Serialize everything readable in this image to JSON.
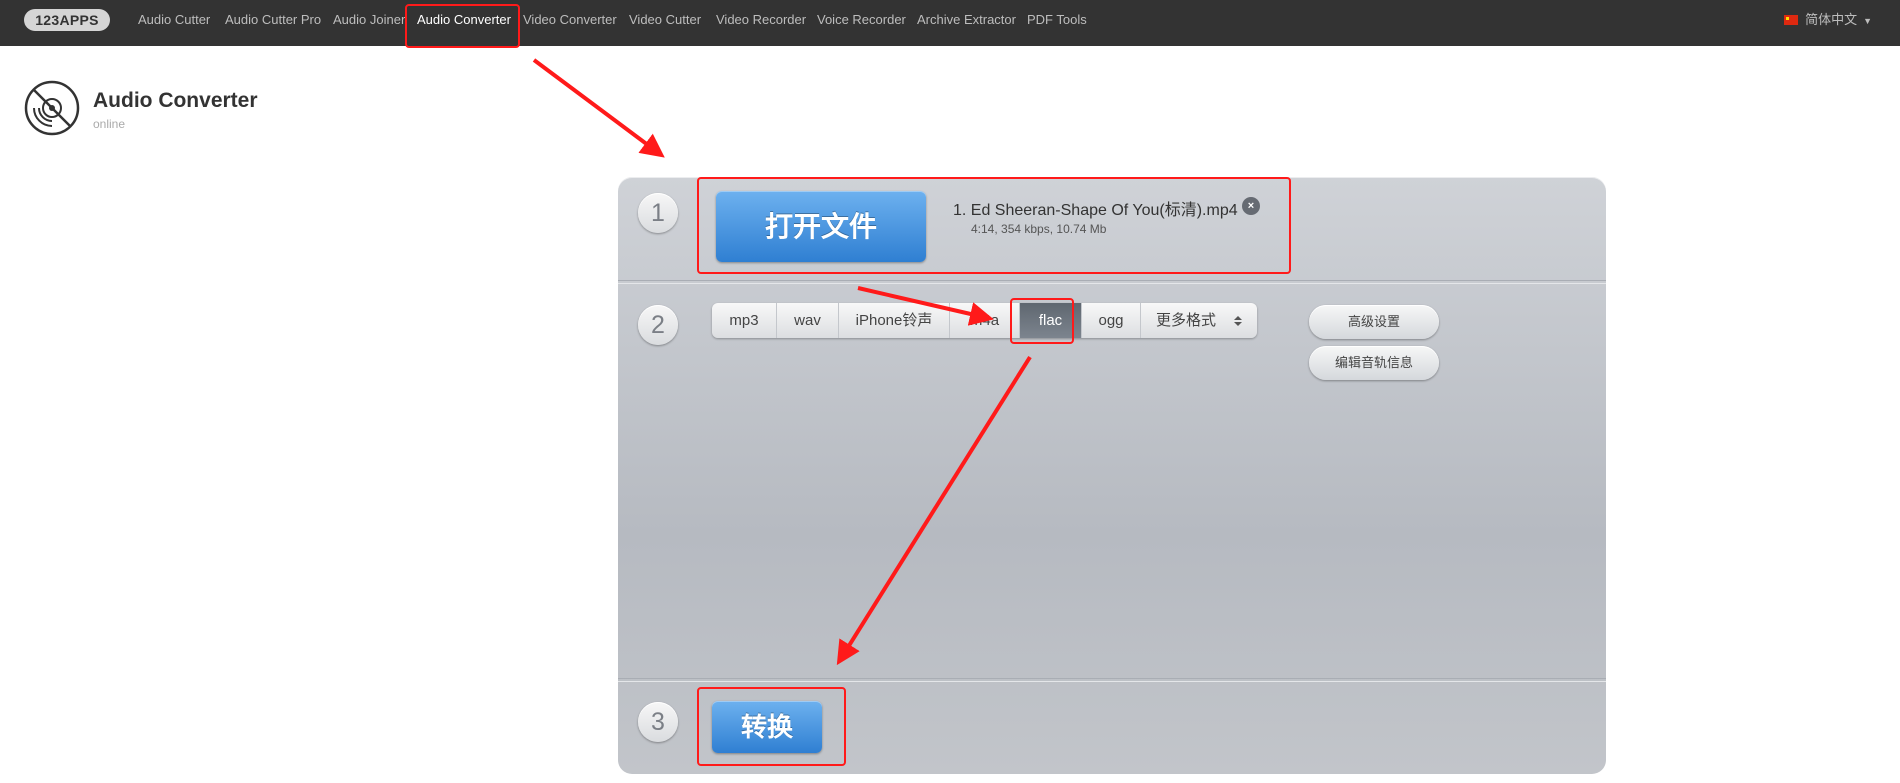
{
  "navbar": {
    "logo": "123APPS",
    "items": [
      {
        "label": "Audio Cutter"
      },
      {
        "label": "Audio Cutter Pro"
      },
      {
        "label": "Audio Joiner"
      },
      {
        "label": "Audio Converter",
        "active": true
      },
      {
        "label": "Video Converter"
      },
      {
        "label": "Video Cutter"
      },
      {
        "label": "Video Recorder"
      },
      {
        "label": "Voice Recorder"
      },
      {
        "label": "Archive Extractor"
      },
      {
        "label": "PDF Tools"
      }
    ],
    "language": "简体中文"
  },
  "app": {
    "title": "Audio Converter",
    "subtitle": "online",
    "icon": "disc-icon"
  },
  "steps": {
    "step1": {
      "number": "1",
      "open_button": "打开文件",
      "file_name": "1. Ed Sheeran-Shape Of You(标清).mp4",
      "file_meta": "4:14, 354 kbps, 10.74 Mb",
      "remove_icon": "close-icon"
    },
    "step2": {
      "number": "2",
      "formats": [
        "mp3",
        "wav",
        "iPhone铃声",
        "m4a",
        "flac",
        "ogg"
      ],
      "selected_format": "flac",
      "more_formats": "更多格式",
      "advanced_settings": "高级设置",
      "edit_track_info": "编辑音轨信息"
    },
    "step3": {
      "number": "3",
      "convert_button": "转换"
    }
  },
  "colors": {
    "navbar_bg": "#333333",
    "accent_blue": "#2f7fd2",
    "annotation_red": "#ff1a1a",
    "selected_format_bg": "#5f6770"
  }
}
